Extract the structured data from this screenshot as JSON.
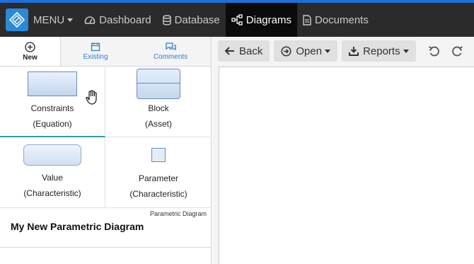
{
  "nav": {
    "menu_label": "MENU",
    "items": [
      {
        "label": "Dashboard",
        "icon": "gauge-icon"
      },
      {
        "label": "Database",
        "icon": "database-icon"
      },
      {
        "label": "Diagrams",
        "icon": "sitemap-icon",
        "active": true
      },
      {
        "label": "Documents",
        "icon": "document-icon"
      }
    ]
  },
  "left_panel": {
    "tabs": [
      {
        "label": "New",
        "icon": "plus-circle-icon",
        "active": true
      },
      {
        "label": "Existing",
        "icon": "calendar-icon"
      },
      {
        "label": "Comments",
        "icon": "comments-icon"
      }
    ],
    "palette": [
      {
        "line1": "Constraints",
        "line2": "(Equation)",
        "selected": true
      },
      {
        "line1": "Block",
        "line2": "(Asset)"
      },
      {
        "line1": "Value",
        "line2": "(Characteristic)"
      },
      {
        "line1": "Parameter",
        "line2": "(Characteristic)"
      }
    ],
    "diagram_type": "Parametric Diagram",
    "diagram_name": "My New Parametric Diagram"
  },
  "toolbar": {
    "back_label": "Back",
    "open_label": "Open",
    "reports_label": "Reports"
  },
  "colors": {
    "accent": "#1e6fd9",
    "topbar": "#2b2b2b",
    "logo": "#2a8ad8",
    "link": "#2a7fd4",
    "selected_underline": "#2e9bb0"
  }
}
